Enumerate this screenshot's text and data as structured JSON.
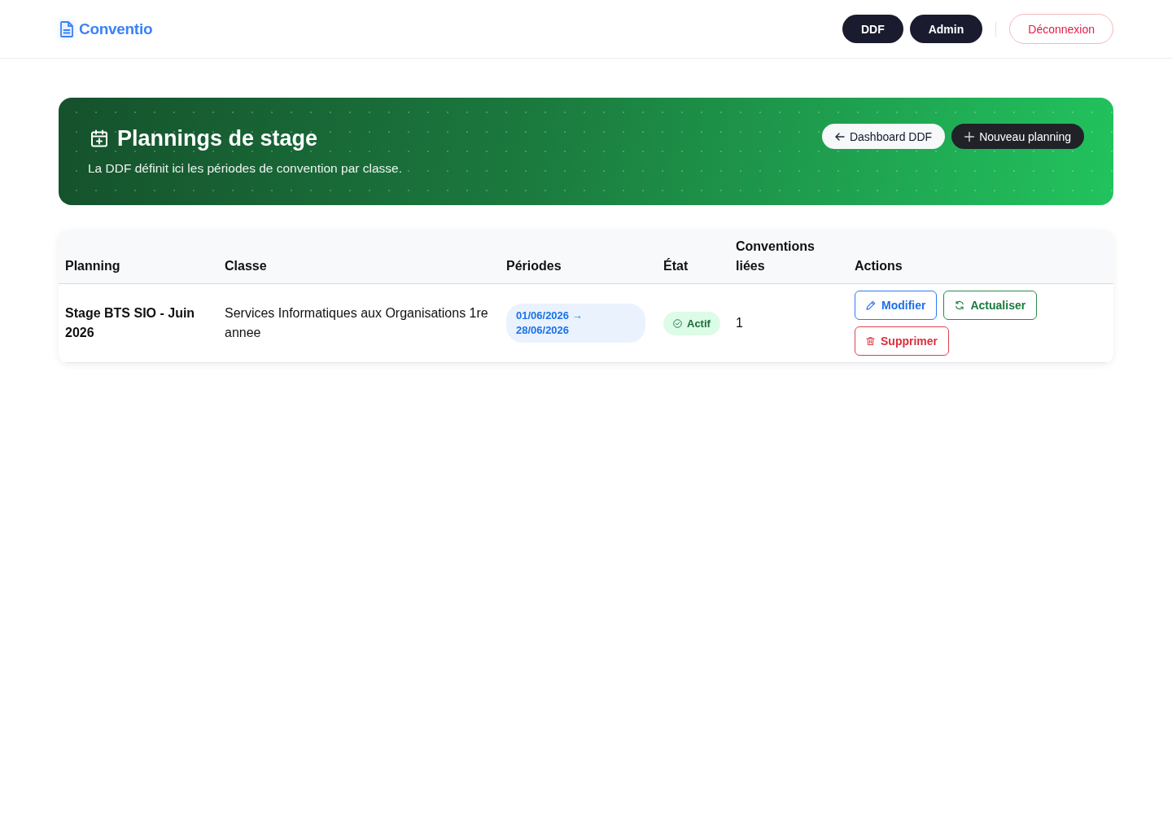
{
  "header": {
    "logo": "Conventio",
    "nav": [
      {
        "label": "DDF"
      },
      {
        "label": "Admin"
      }
    ],
    "logout": "Déconnexion"
  },
  "hero": {
    "title": "Plannings de stage",
    "subtitle": "La DDF définit ici les périodes de convention par classe.",
    "actions": [
      {
        "label": "Dashboard DDF",
        "kind": "back"
      },
      {
        "label": "Nouveau planning",
        "kind": "create"
      }
    ]
  },
  "table": {
    "columns": [
      "Planning",
      "Classe",
      "Périodes",
      "État",
      "Conventions liées",
      "Actions"
    ],
    "rows": [
      {
        "planning": "Stage BTS SIO - Juin 2026",
        "classe": "Services Informatiques aux Organisations 1re annee",
        "periods": [
          "01/06/2026 → 28/06/2026"
        ],
        "status": {
          "label": "Actif",
          "kind": "active"
        },
        "conventions": "1",
        "actions": [
          {
            "label": "Modifier",
            "kind": "edit"
          },
          {
            "label": "Actualiser",
            "kind": "refresh"
          },
          {
            "label": "Supprimer",
            "kind": "delete"
          }
        ]
      }
    ]
  }
}
